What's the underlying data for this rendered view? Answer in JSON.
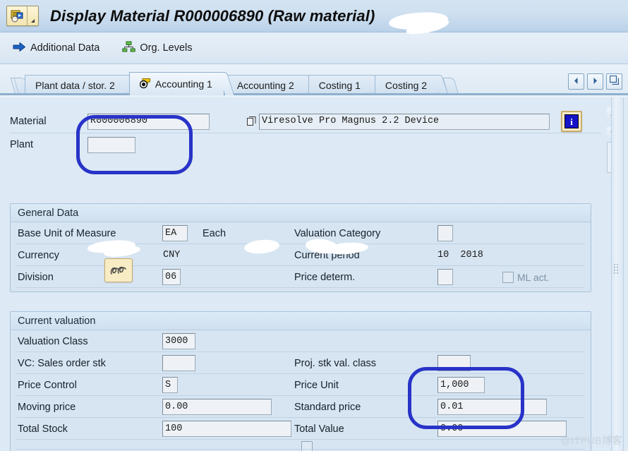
{
  "window": {
    "title_prefix": "Display Material",
    "material_number": "R000006890",
    "title_suffix": "Raw material)",
    "title_open_paren": "(",
    "sysmenu_icon": "sap-menu-icon",
    "sysmenu_dropdown_icon": "dropdown-triangle-icon"
  },
  "toolbar": {
    "items": [
      {
        "label": "Additional Data",
        "icon": "arrow-right-icon"
      },
      {
        "label": "Org. Levels",
        "icon": "org-hierarchy-icon"
      }
    ]
  },
  "tabs": {
    "items": [
      {
        "label": "Plant data / stor. 2",
        "active": false,
        "icon": null
      },
      {
        "label": "Accounting 1",
        "active": true,
        "icon": "stamp-icon"
      },
      {
        "label": "Accounting 2",
        "active": false,
        "icon": null
      },
      {
        "label": "Costing 1",
        "active": false,
        "icon": null
      },
      {
        "label": "Costing 2",
        "active": false,
        "icon": null
      }
    ],
    "nav": [
      {
        "name": "prev-tab-button",
        "icon": "triangle-left-icon"
      },
      {
        "name": "next-tab-button",
        "icon": "triangle-right-icon"
      },
      {
        "name": "tab-list-button",
        "icon": "windows-list-icon"
      }
    ]
  },
  "header_fields": {
    "material_label": "Material",
    "material_value": "R000006890",
    "material_description": "Viresolve Pro Magnus 2.2 Device",
    "material_matchcode_icon": "matchcode-icon",
    "plant_label": "Plant",
    "plant_value": "",
    "plant_description": "",
    "info_button_icon": "info-icon",
    "info_button_label": "i"
  },
  "general_data": {
    "title": "General Data",
    "rows": [
      {
        "label": "Base Unit of Measure",
        "value": "EA",
        "suffix": "Each",
        "right_label": "Valuation Category",
        "right_value": ""
      },
      {
        "label": "Currency",
        "value": "CNY",
        "suffix": "",
        "right_label": "Current period",
        "right_value": "10  2018"
      },
      {
        "label": "Division",
        "value": "06",
        "suffix": "",
        "right_label": "Price determ.",
        "right_value": ""
      }
    ],
    "ml_act_label": "ML act.",
    "ml_act_checked": false
  },
  "current_valuation": {
    "title": "Current valuation",
    "rows": [
      {
        "label": "Valuation Class",
        "value": "3000",
        "right_label": "",
        "right_value": null
      },
      {
        "label": "VC: Sales order stk",
        "value": "",
        "right_label": "Proj. stk val. class",
        "right_value": ""
      },
      {
        "label": "Price Control",
        "value": "S",
        "right_label": "Price Unit",
        "right_value": "1,000"
      },
      {
        "label": "Moving price",
        "value": "0.00",
        "right_label": "Standard price",
        "right_value": "0.01"
      },
      {
        "label": "Total Stock",
        "value": "100",
        "right_label": "Total Value",
        "right_value": "0.00"
      }
    ]
  },
  "annotations": [
    {
      "name": "material-plant-highlight",
      "color": "#2833c8"
    },
    {
      "name": "price-highlight",
      "color": "#2833c8"
    }
  ],
  "watermark": "@ITPUB博客"
}
